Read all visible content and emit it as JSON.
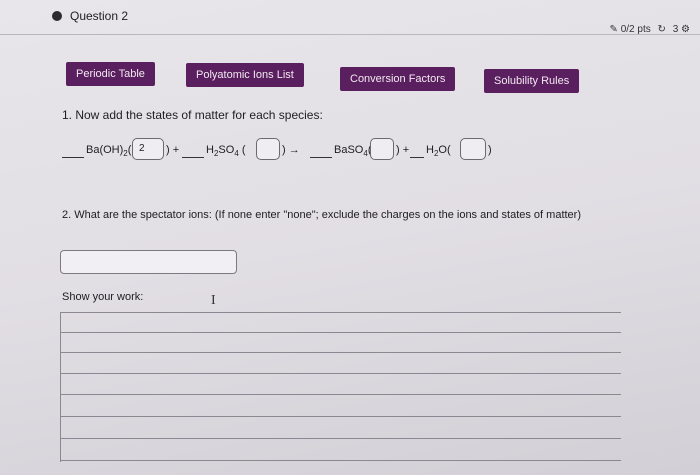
{
  "question": {
    "title": "Question 2",
    "points": "0/2 pts",
    "attempts": "3"
  },
  "tabs": [
    {
      "label": "Periodic Table"
    },
    {
      "label": "Polyatomic Ions List"
    },
    {
      "label": "Conversion Factors"
    },
    {
      "label": "Solubility Rules"
    }
  ],
  "part1": {
    "prompt": "1. Now add the states of matter for each species:",
    "species": [
      {
        "formula": "Ba(OH)",
        "sub": "2",
        "state": "2",
        "tail": ""
      },
      {
        "formula": "H",
        "sub": "2",
        "rest": "SO",
        "sub2": "4",
        "state": ""
      },
      {
        "formula": "BaSO",
        "sub": "4",
        "state": ""
      },
      {
        "formula": "H",
        "sub": "2",
        "rest": "O",
        "state": ""
      }
    ],
    "plus": "+",
    "arrow": "→"
  },
  "part2": {
    "prompt": "2. What are the spectator ions: (If none enter \"none\"; exclude the charges on the ions and states of matter)",
    "answer": ""
  },
  "work": {
    "label": "Show your work:"
  },
  "colors": {
    "tab_bg": "#5a1f5e",
    "tab_text": "#f2e9f2"
  }
}
